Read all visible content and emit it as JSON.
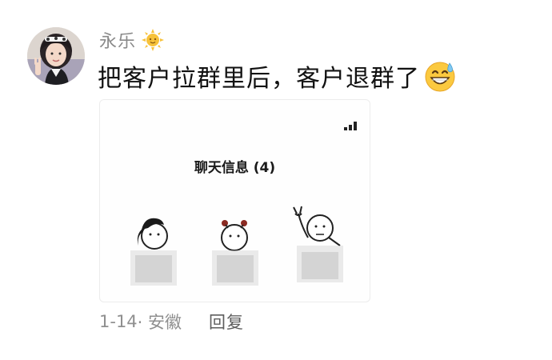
{
  "comment": {
    "username": "永乐",
    "text": "把客户拉群里后，客户退群了",
    "badge_icon": "sun-icon",
    "text_emoji_icon": "grinning-sweat-icon",
    "date": "1-14",
    "location": "· 安徽",
    "reply_label": "回复"
  },
  "image_card": {
    "title": "聊天信息 (4)",
    "status_icon": "signal-icon",
    "figures": [
      "figure-ponytail",
      "figure-bear-ears",
      "figure-waving"
    ]
  },
  "colors": {
    "username": "#8a8a8a",
    "text": "#111111",
    "meta": "#8f8f8f",
    "reply": "#5e5e5e"
  }
}
